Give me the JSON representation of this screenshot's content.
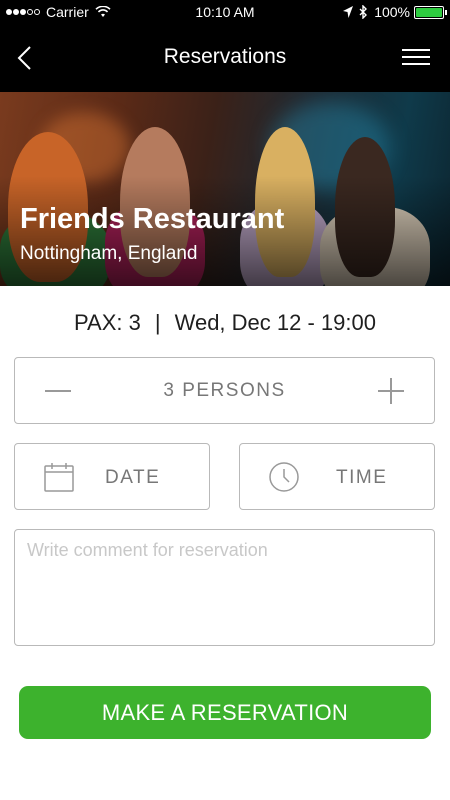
{
  "status_bar": {
    "carrier": "Carrier",
    "time": "10:10 AM",
    "battery": "100%",
    "battery_level": 1.0
  },
  "nav": {
    "title": "Reservations",
    "back_icon": "chevron-left-icon",
    "menu_icon": "hamburger-menu-icon"
  },
  "restaurant": {
    "name": "Friends Restaurant",
    "location": "Nottingham, England"
  },
  "summary": {
    "pax": "PAX: 3",
    "separator": "|",
    "datetime": "Wed, Dec 12 - 19:00"
  },
  "form": {
    "persons_label": "3 PERSONS",
    "date_label": "DATE",
    "time_label": "TIME",
    "comment_placeholder": "Write comment for reservation",
    "comment_value": ""
  },
  "cta": {
    "label": "MAKE A RESERVATION"
  },
  "colors": {
    "accent": "#3db22d",
    "border": "#b9b9b9",
    "muted_text": "#777777"
  }
}
